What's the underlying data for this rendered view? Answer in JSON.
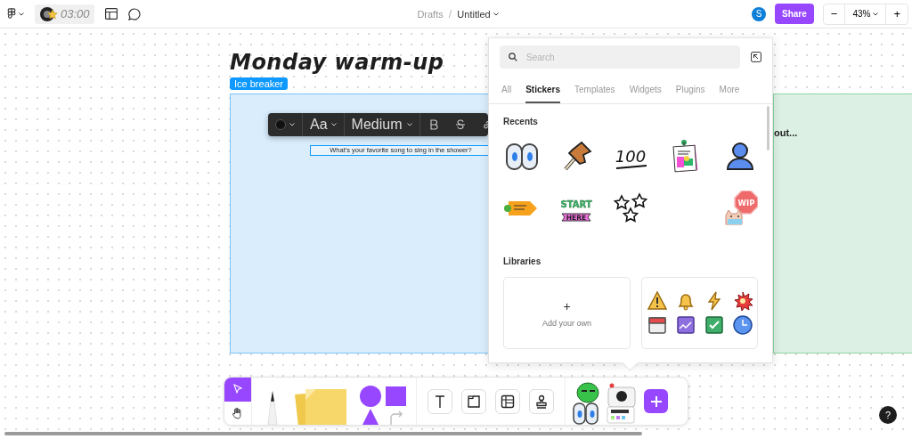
{
  "topbar": {
    "timer": "03:00",
    "breadcrumb_parent": "Drafts",
    "breadcrumb_separator": "/",
    "file_title": "Untitled",
    "avatar_initial": "S",
    "share_label": "Share",
    "zoom_out": "−",
    "zoom_level": "43%",
    "zoom_in": "+"
  },
  "canvas": {
    "section_title": "Monday warm-up",
    "section_tag": "Ice breaker",
    "prompt": "What’s your favorite song to sing in the shower?",
    "green_section_text": "out..."
  },
  "text_toolbar": {
    "font_button": "Aa",
    "font_weight": "Medium"
  },
  "panel": {
    "search_placeholder": "Search",
    "tabs": [
      {
        "label": "All",
        "selected": false
      },
      {
        "label": "Stickers",
        "selected": true
      },
      {
        "label": "Templates",
        "selected": false
      },
      {
        "label": "Widgets",
        "selected": false
      },
      {
        "label": "Plugins",
        "selected": false
      },
      {
        "label": "More",
        "selected": false
      }
    ],
    "recents_heading": "Recents",
    "recents": [
      {
        "kind": "eyes"
      },
      {
        "kind": "pushpin"
      },
      {
        "kind": "hundred",
        "texts": [
          "100"
        ]
      },
      {
        "kind": "poster"
      },
      {
        "kind": "person"
      },
      {
        "kind": "carrot"
      },
      {
        "kind": "banner",
        "texts": [
          "START",
          "HERE"
        ]
      },
      {
        "kind": "stars"
      },
      {
        "kind": "empty"
      },
      {
        "kind": "cat",
        "texts": [
          "WIP"
        ]
      }
    ],
    "libraries_heading": "Libraries",
    "add_plus": "+",
    "add_label": "Add your own"
  },
  "tools": [
    {
      "kind": "select",
      "selected": true
    },
    {
      "kind": "hand",
      "selected": false
    }
  ],
  "help": "?"
}
